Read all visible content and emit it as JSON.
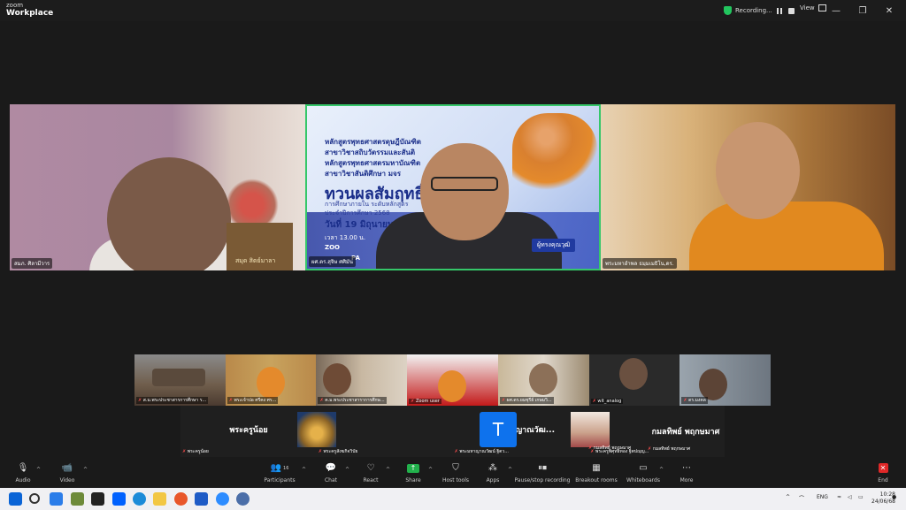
{
  "app": {
    "brand_top": "zoom",
    "brand_bottom": "Workplace"
  },
  "titlebar": {
    "recording_label": "Recording...",
    "view_label": "View",
    "window_controls": [
      "—",
      "❐",
      "✕"
    ]
  },
  "main_tiles": [
    {
      "name": "สมภ. ศิลามีวาร",
      "plaque_text": "สมุด  สิตย์มาลา"
    },
    {
      "name": "ผศ.ดร.สุจิษ ศศิมัน",
      "poster": {
        "line1": "หลักสูตรพุทธศาสตรดุษฎีบัณฑิต",
        "line2": "สาขาวิชาสถิบวัตรรมและสันติ",
        "line3": "หลักสูตรพุทธศาสตรมหาบัณฑิต",
        "line4": "สาขาวิชาสันติศึกษา มจร",
        "headline": "ทวนผลสัมฤทธิ์",
        "sub1": "การศึกษาภายใน ระดับหลักสูตร",
        "sub2": "ประจำปีการศึกษา 2568",
        "date": "วันที่ 19 มิถุนายน 25",
        "time": "เวลา 13.00 น.",
        "zoom_label": "ZOO",
        "pa_label": "PA",
        "badge": "ผู้ทรงคุณวุฒิ"
      }
    },
    {
      "name": "พระมหาอำพล ธมฺมเมธิโน,ดร."
    }
  ],
  "gallery_row": [
    {
      "name": "ส.ม.พระประชาสารการศึกษา ร..."
    },
    {
      "name": "พระเจ้าปอ    ศรีคง ศร..."
    },
    {
      "name": "ค.ม.พระประชาสาราการศึกษ..."
    },
    {
      "name": "Zoom user"
    },
    {
      "name": "ผศ.ดร.ยมชุรีย์  เกษมวิ..."
    },
    {
      "name": "wit_analog"
    },
    {
      "name": "ดร.มงคล"
    }
  ],
  "gallery_row2": [
    {
      "big": "พระครูน้อย",
      "name": "พระครูน้อย"
    },
    {
      "big": "",
      "name": "พระครูสังฆกิจวิบัย"
    },
    {
      "big": "พระมหาญาณวัฒ...",
      "name": "พระมหาญาณวัฒน์ ฐิตว..."
    },
    {
      "big": "",
      "avatar_letter": "T",
      "name": "พระครูพิศุทธิ์ทอง ฐิตปญฺญ..."
    },
    {
      "big": "",
      "name": "กมลทิพย์  พฤกษมาศ"
    },
    {
      "big": "กมลทิพย์ พฤกษมาศ",
      "name": "กมลทิพย์ พฤกษมาศ"
    }
  ],
  "toolbar": {
    "audio": "Audio",
    "video": "Video",
    "participants": "Participants",
    "participants_count": "16",
    "chat": "Chat",
    "react": "React",
    "share": "Share",
    "host_tools": "Host tools",
    "apps": "Apps",
    "pause_rec": "Pause/stop recording",
    "breakout": "Breakout rooms",
    "whiteboards": "Whiteboards",
    "more": "More",
    "end": "End"
  },
  "taskbar": {
    "lang": "ENG",
    "time": "10:28",
    "date": "24/06/68"
  },
  "colors": {
    "active_speaker": "#35c76a",
    "share": "#22b14c",
    "end": "#e02828",
    "zoom_blue": "#0e72ed"
  }
}
